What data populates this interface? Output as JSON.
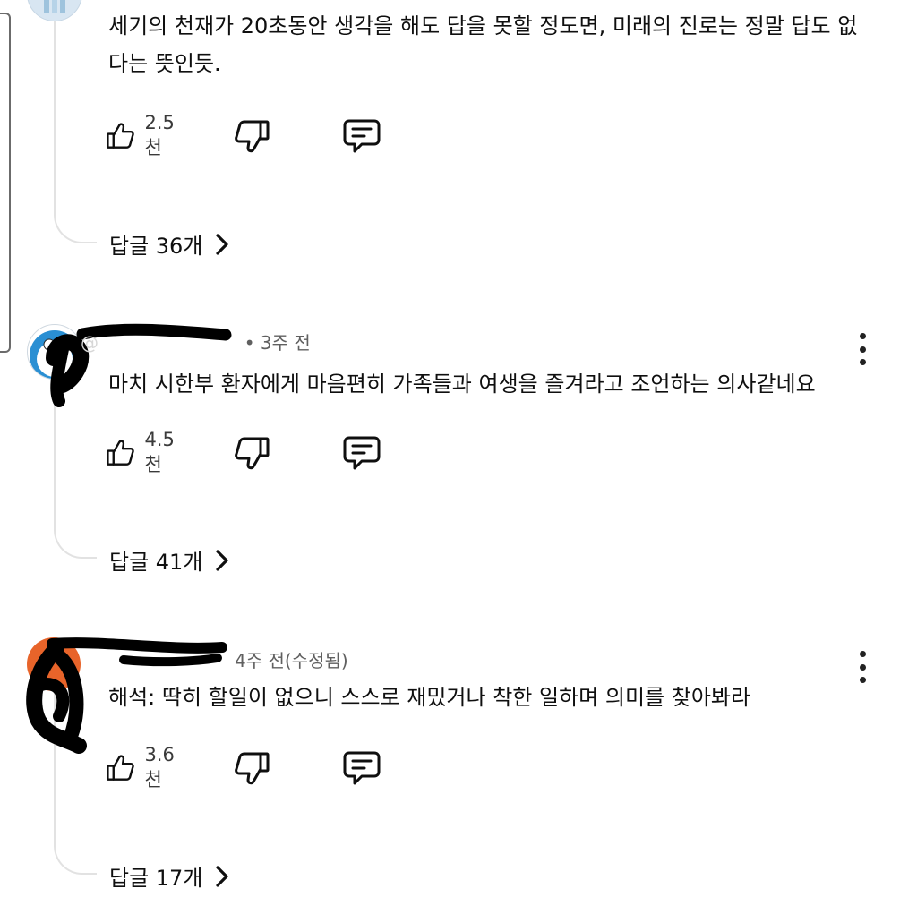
{
  "comments": [
    {
      "author": "",
      "time": "",
      "text": "세기의 천재가 20초동안 생각을 해도 답을 못할 정도면, 미래의 진로는 정말 답도 없다는 뜻인듯.",
      "likes": "2.5천",
      "replies": "답글 36개"
    },
    {
      "author": "@",
      "time": "• 3주 전",
      "text": "마치 시한부 환자에게 마음편히 가족들과 여생을 즐겨라고 조언하는 의사같네요",
      "likes": "4.5천",
      "replies": "답글 41개"
    },
    {
      "author": "",
      "time": "4주 전(수정됨)",
      "text": "해석: 딱히 할일이 없으니 스스로 재밌거나 착한 일하며 의미를 찾아봐라",
      "likes": "3.6천",
      "replies": "답글 17개"
    }
  ],
  "icons": {
    "like": "thumbs-up-icon",
    "dislike": "thumbs-down-icon",
    "reply": "reply-comment-icon",
    "more": "more-vert-icon",
    "chevron": "chevron-right-icon"
  },
  "colors": {
    "text": "#0f0f0f",
    "meta": "#606060",
    "thread_line": "#e2e2e2",
    "redaction": "#000000"
  }
}
